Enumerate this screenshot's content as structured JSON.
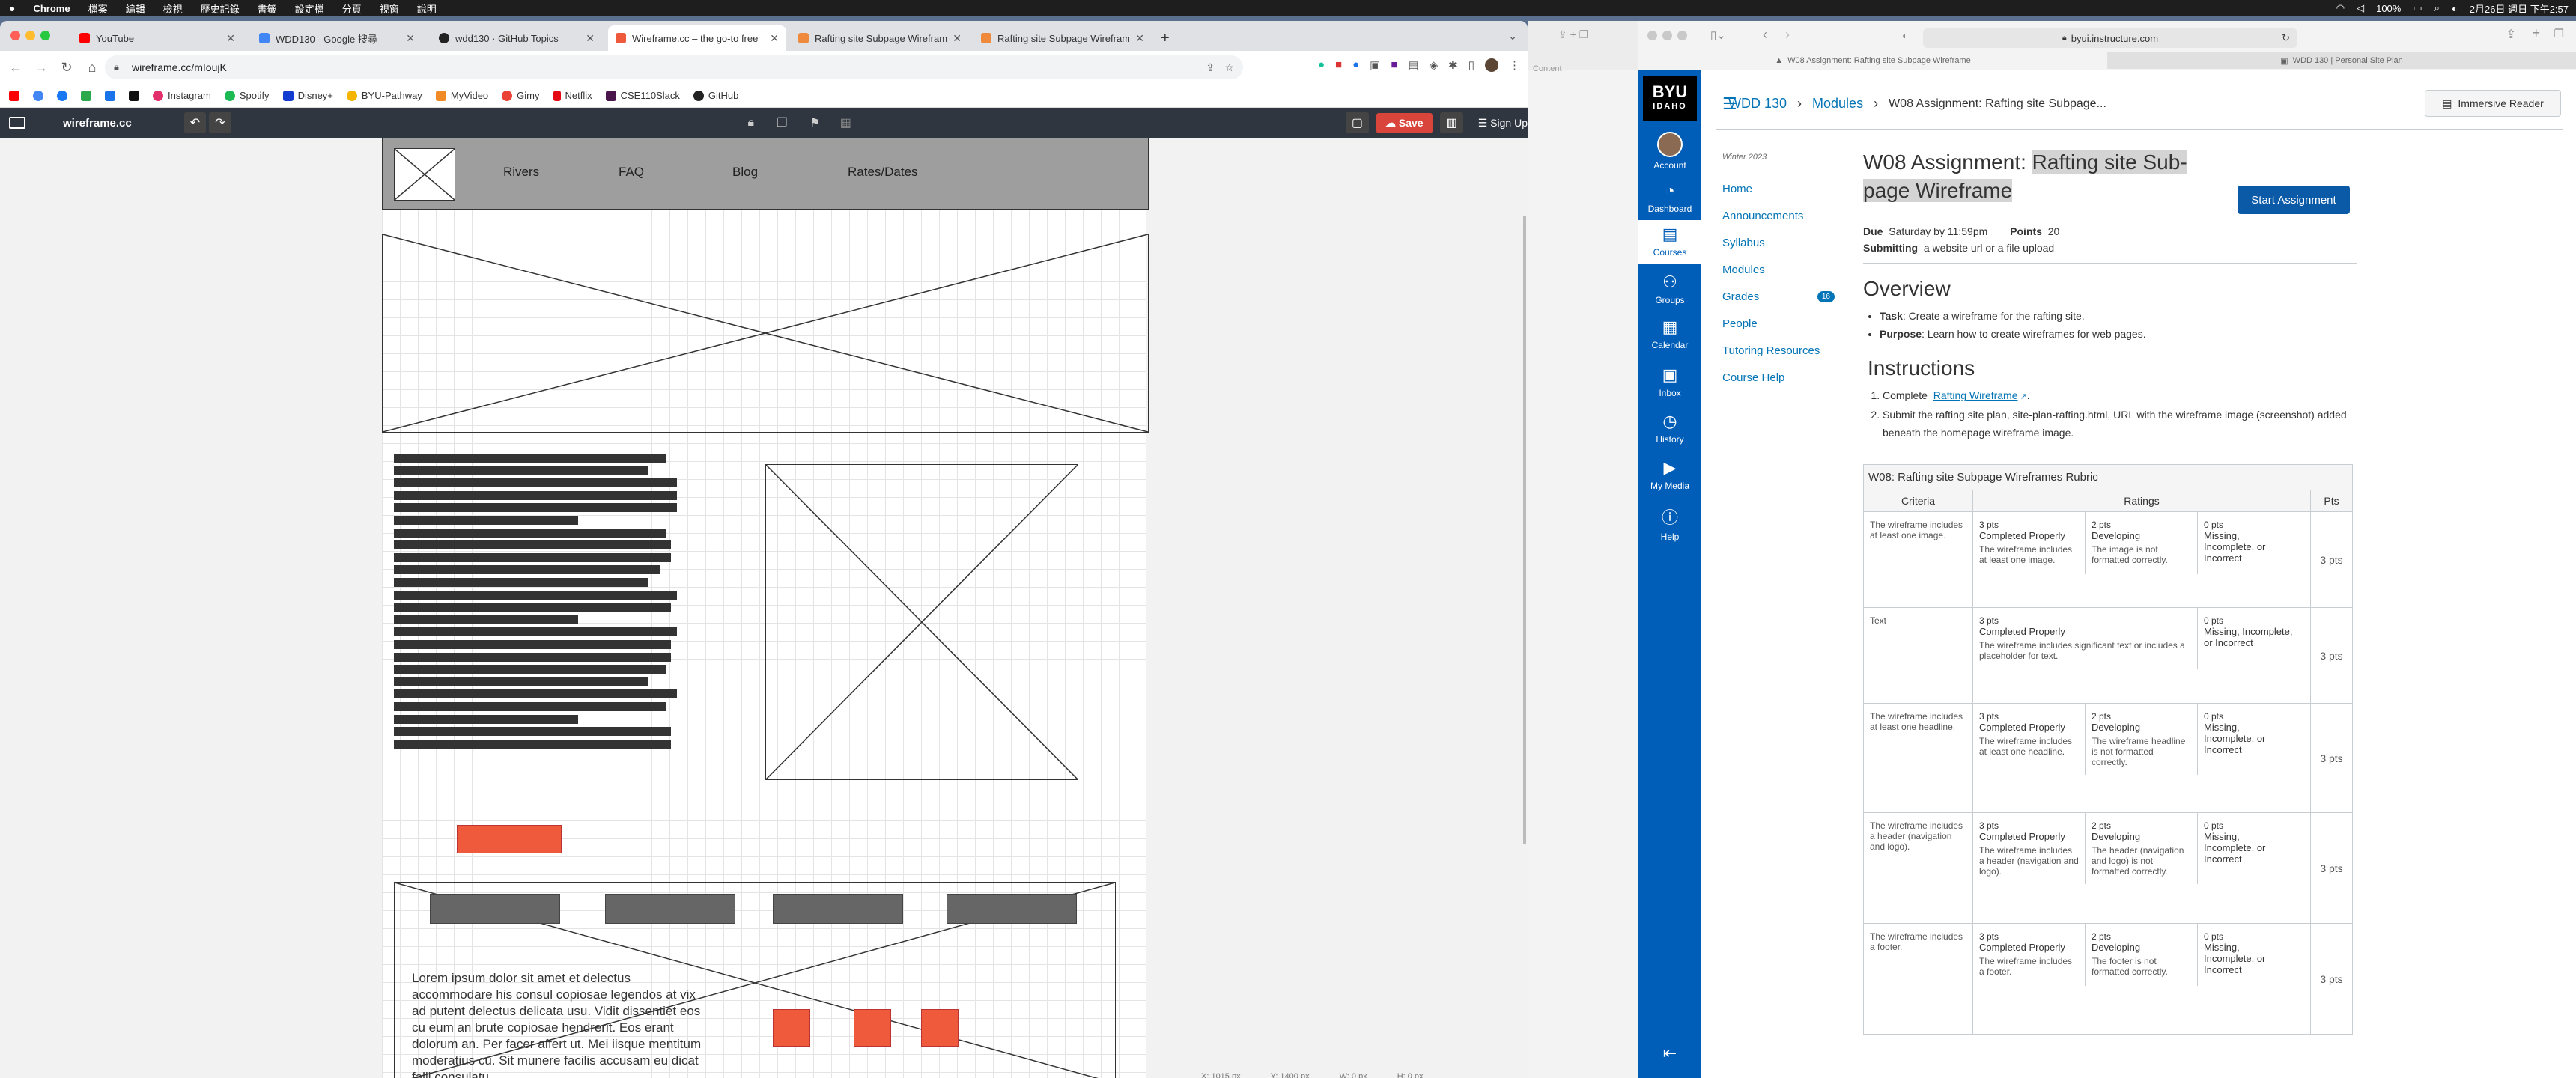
{
  "menubar": {
    "app": "Chrome",
    "items": [
      "檔案",
      "編輯",
      "檢視",
      "歷史記錄",
      "書籤",
      "設定檔",
      "分頁",
      "視窗",
      "說明"
    ],
    "battery": "100%",
    "clock": "2月26日 週日 下午2:57"
  },
  "chrome": {
    "tabs": [
      {
        "title": "YouTube",
        "color": "#ff0000"
      },
      {
        "title": "WDD130 - Google 搜尋",
        "color": "#4285f4"
      },
      {
        "title": "wdd130 · GitHub Topics",
        "color": "#222222"
      },
      {
        "title": "Wireframe.cc – the go-to free",
        "color": "#ef5a3c"
      },
      {
        "title": "Rafting site Subpage Wirefram",
        "color": "#ef8a3c"
      },
      {
        "title": "Rafting site Subpage Wirefram",
        "color": "#ef8a3c"
      }
    ],
    "new_tab": "+",
    "url": "wireframe.cc/mIoujK",
    "bookmarks": [
      {
        "label": "",
        "color": "#ff0000"
      },
      {
        "label": "",
        "color": "#4285f4"
      },
      {
        "label": "",
        "color": "#1877f2"
      },
      {
        "label": "",
        "color": "#2ba84a"
      },
      {
        "label": "",
        "color": "#1a73e8"
      },
      {
        "label": "",
        "color": "#111111"
      },
      {
        "label": "Instagram",
        "color": "#e1306c"
      },
      {
        "label": "Spotify",
        "color": "#1db954"
      },
      {
        "label": "Disney+",
        "color": "#113ccf"
      },
      {
        "label": "BYU-Pathway",
        "color": "#f4b400"
      },
      {
        "label": "MyVideo",
        "color": "#f08a24"
      },
      {
        "label": "Gimy",
        "color": "#ea4335"
      },
      {
        "label": "Netflix",
        "color": "#e50914"
      },
      {
        "label": "CSE110Slack",
        "color": "#4a154b"
      },
      {
        "label": "GitHub",
        "color": "#222222"
      }
    ]
  },
  "wireframe": {
    "brand": "wireframe.cc",
    "save": "Save",
    "signup": "Sign Up",
    "nav": [
      "Rivers",
      "FAQ",
      "Blog",
      "Rates/Dates"
    ],
    "lorem": "Lorem ipsum dolor sit amet et delectus accommodare his consul copiosae legendos at vix ad putent delectus delicata usu. Vidit dissentiet eos cu eum an brute copiosae hendrerit. Eos erant dolorum an. Per facer affert ut. Mei iisque mentitum moderatius cu. Sit munere facilis accusam eu dicat falli consulatu",
    "text_line_widths": [
      96,
      90,
      100,
      100,
      100,
      65,
      96,
      98,
      98,
      94,
      90,
      100,
      98,
      65,
      100,
      98,
      98,
      96,
      90,
      100,
      96,
      65,
      98,
      98
    ],
    "coords": {
      "x": "X: 1015 px",
      "y": "Y: 1400 px",
      "w": "W: 0 px",
      "h": "H: 0 px"
    }
  },
  "safari": {
    "url": "byui.instructure.com",
    "tabs": [
      "W08 Assignment: Rafting site Subpage Wireframe",
      "WDD 130 | Personal Site Plan"
    ],
    "left_partial": "Content"
  },
  "canvas": {
    "logo": {
      "line1": "BYU",
      "line2": "IDAHO"
    },
    "global_nav": [
      "Account",
      "Dashboard",
      "Courses",
      "Groups",
      "Calendar",
      "Inbox",
      "History",
      "My Media",
      "Help"
    ],
    "breadcrumb": [
      "WDD 130",
      "Modules",
      "W08 Assignment: Rafting site Subpage..."
    ],
    "immersive": "Immersive Reader",
    "term": "Winter 2023",
    "course_nav": [
      "Home",
      "Announcements",
      "Syllabus",
      "Modules",
      "Grades",
      "People",
      "Tutoring Resources",
      "Course Help"
    ],
    "grades_badge": "16",
    "title_plain": "W08 Assignment: ",
    "title_hl": "Rafting site Sub-page Wireframe",
    "start": "Start Assignment",
    "due_label": "Due",
    "due_value": "Saturday by 11:59pm",
    "points_label": "Points",
    "points_value": "20",
    "submitting_label": "Submitting",
    "submitting_value": "a website url or a file upload",
    "overview": "Overview",
    "task_label": "Task",
    "task_text": ": Create a wireframe for the rafting site.",
    "purpose_label": "Purpose",
    "purpose_text": ": Learn how to create wireframes for web pages.",
    "instructions": "Instructions",
    "step1_pre": "Complete",
    "step1_link": "Rafting Wireframe",
    "step2": "Submit the rafting site plan, site-plan-rafting.html, URL with the wireframe image (screenshot) added beneath the homepage wireframe image.",
    "rubric_title": "W08: Rafting site Subpage Wireframes Rubric",
    "rubric_headers": [
      "Criteria",
      "Ratings",
      "Pts"
    ],
    "rubric": [
      {
        "criteria": "The wireframe includes at least one image.",
        "pts": "3 pts",
        "ratings": [
          {
            "p": "3 pts",
            "l": "Completed Properly",
            "d": "The wireframe includes at least one image."
          },
          {
            "p": "2 pts",
            "l": "Developing",
            "d": "The image is not formatted correctly."
          },
          {
            "p": "0 pts",
            "l": "Missing, Incomplete, or Incorrect",
            "d": ""
          }
        ]
      },
      {
        "criteria": "Text",
        "pts": "3 pts",
        "ratings": [
          {
            "p": "3 pts",
            "l": "Completed Properly",
            "d": "The wireframe includes significant text or includes a placeholder for text."
          },
          {
            "p": "0 pts",
            "l": "Missing, Incomplete, or Incorrect",
            "d": ""
          }
        ]
      },
      {
        "criteria": "The wireframe includes at least one headline.",
        "pts": "3 pts",
        "ratings": [
          {
            "p": "3 pts",
            "l": "Completed Properly",
            "d": "The wireframe includes at least one headline."
          },
          {
            "p": "2 pts",
            "l": "Developing",
            "d": "The wireframe headline is not formatted correctly."
          },
          {
            "p": "0 pts",
            "l": "Missing, Incomplete, or Incorrect",
            "d": ""
          }
        ]
      },
      {
        "criteria": "The wireframe includes a header (navigation and logo).",
        "pts": "3 pts",
        "ratings": [
          {
            "p": "3 pts",
            "l": "Completed Properly",
            "d": "The wireframe includes a header (navigation and logo)."
          },
          {
            "p": "2 pts",
            "l": "Developing",
            "d": "The header (navigation and logo) is not formatted correctly."
          },
          {
            "p": "0 pts",
            "l": "Missing, Incomplete, or Incorrect",
            "d": ""
          }
        ]
      },
      {
        "criteria": "The wireframe includes a footer.",
        "pts": "3 pts",
        "ratings": [
          {
            "p": "3 pts",
            "l": "Completed Properly",
            "d": "The wireframe includes a footer."
          },
          {
            "p": "2 pts",
            "l": "Developing",
            "d": "The footer is not formatted correctly."
          },
          {
            "p": "0 pts",
            "l": "Missing, Incomplete, or Incorrect",
            "d": ""
          }
        ]
      }
    ]
  }
}
